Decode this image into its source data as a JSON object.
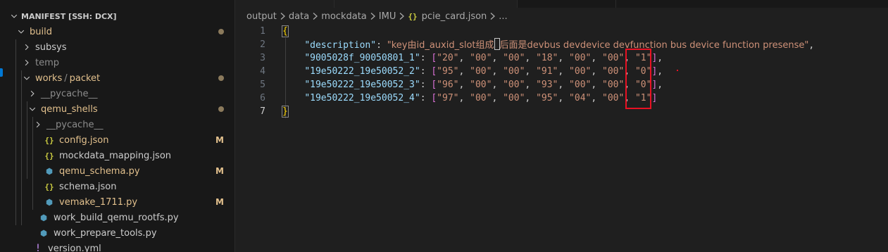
{
  "explorer": {
    "section_title": "MANIFEST [SSH: DCX]",
    "items": [
      {
        "label": "build",
        "kind": "folder-open",
        "depth": 0,
        "deco": "dot",
        "style": "git"
      },
      {
        "label": "subsys",
        "kind": "folder",
        "depth": 1,
        "deco": "",
        "style": "norm"
      },
      {
        "label": "temp",
        "kind": "folder",
        "depth": 1,
        "deco": "",
        "style": "dim"
      },
      {
        "label": "works",
        "kind": "folder-open",
        "depth": 1,
        "deco": "dot",
        "style": "git",
        "compact_suffix": "packet"
      },
      {
        "label": "__pycache__",
        "kind": "folder",
        "depth": 2,
        "deco": "",
        "style": "dim"
      },
      {
        "label": "qemu_shells",
        "kind": "folder-open",
        "depth": 2,
        "deco": "dot",
        "style": "git"
      },
      {
        "label": "__pycache__",
        "kind": "folder",
        "depth": 3,
        "deco": "",
        "style": "dim"
      },
      {
        "label": "config.json",
        "kind": "json",
        "depth": 3,
        "deco": "M",
        "style": "git"
      },
      {
        "label": "mockdata_mapping.json",
        "kind": "json",
        "depth": 3,
        "deco": "",
        "style": "norm"
      },
      {
        "label": "qemu_schema.py",
        "kind": "py",
        "depth": 3,
        "deco": "M",
        "style": "git"
      },
      {
        "label": "schema.json",
        "kind": "json",
        "depth": 3,
        "deco": "",
        "style": "norm"
      },
      {
        "label": "vemake_1711.py",
        "kind": "py",
        "depth": 3,
        "deco": "M",
        "style": "git"
      },
      {
        "label": "work_build_qemu_rootfs.py",
        "kind": "py",
        "depth": 2,
        "deco": "",
        "style": "norm"
      },
      {
        "label": "work_prepare_tools.py",
        "kind": "py",
        "depth": 2,
        "deco": "",
        "style": "norm"
      },
      {
        "label": "version.yml",
        "kind": "yml",
        "depth": 1,
        "deco": "",
        "style": "norm"
      }
    ],
    "modified_badge": "M",
    "path_separator": "/"
  },
  "breadcrumb": {
    "parts": [
      "output",
      "data",
      "mockdata",
      "IMU",
      "pcie_card.json",
      "..."
    ]
  },
  "editor": {
    "line_numbers": [
      "1",
      "2",
      "3",
      "4",
      "5",
      "6",
      "7"
    ],
    "active_line": 7,
    "open_brace": "{",
    "close_brace": "}",
    "description_key": "\"description\"",
    "description_value_pre": "\"key由id_auxid_slot组成",
    "description_value_post": "后面是devbus devdevice devfunction bus device function presense\"",
    "rows": [
      {
        "key": "\"9005028f_90050801_1\"",
        "values": [
          "\"20\"",
          "\"00\"",
          "\"00\"",
          "\"18\"",
          "\"00\"",
          "\"00\"",
          "\"1\""
        ],
        "trailing": ","
      },
      {
        "key": "\"19e50222_19e50052_2\"",
        "values": [
          "\"95\"",
          "\"00\"",
          "\"00\"",
          "\"91\"",
          "\"00\"",
          "\"00\"",
          "\"0\""
        ],
        "trailing": ","
      },
      {
        "key": "\"19e50222_19e50052_3\"",
        "values": [
          "\"96\"",
          "\"00\"",
          "\"00\"",
          "\"93\"",
          "\"00\"",
          "\"00\"",
          "\"0\""
        ],
        "trailing": ","
      },
      {
        "key": "\"19e50222_19e50052_4\"",
        "values": [
          "\"97\"",
          "\"00\"",
          "\"00\"",
          "\"95\"",
          "\"04\"",
          "\"00\"",
          "\"1\""
        ],
        "trailing": ""
      }
    ]
  },
  "icons": {
    "json_file": "json-file-icon",
    "python_file": "python-file-icon",
    "yaml_file": "yaml-file-icon",
    "chevron_down": "chevron-down-icon",
    "chevron_right": "chevron-right-icon"
  },
  "colors": {
    "modified": "#e2c08d",
    "annotation_box": "#e81123",
    "json_icon": "#cbcb41",
    "python_icon": "#519aba"
  }
}
